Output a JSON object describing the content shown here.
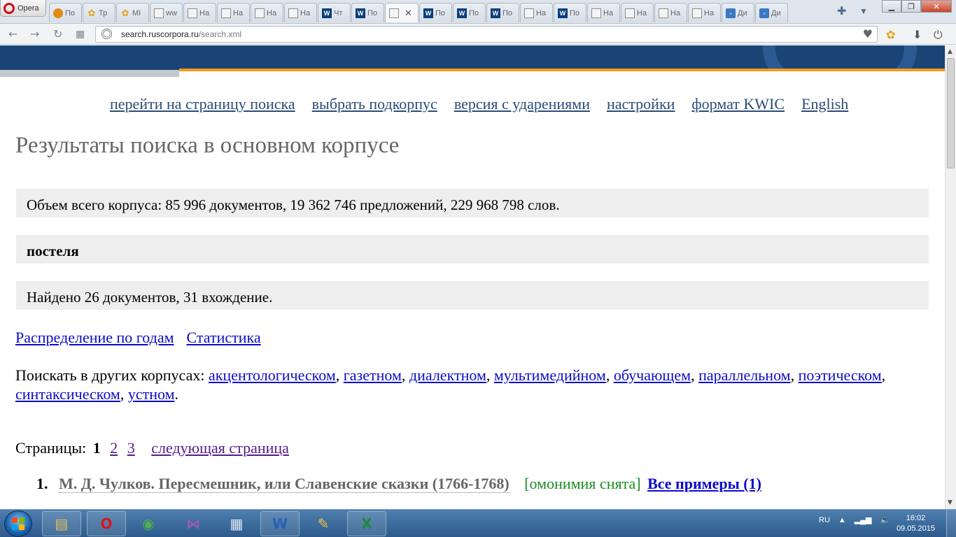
{
  "browser": {
    "menu_label": "Opera",
    "tabs": [
      {
        "label": "По",
        "icon": "orange-ball-icon"
      },
      {
        "label": "Тр",
        "icon": "flower-icon"
      },
      {
        "label": "МІ",
        "icon": "flower-icon"
      },
      {
        "label": "ww",
        "icon": "page-icon"
      },
      {
        "label": "На",
        "icon": "page-icon"
      },
      {
        "label": "На",
        "icon": "page-icon"
      },
      {
        "label": "На",
        "icon": "page-icon"
      },
      {
        "label": "На",
        "icon": "page-icon"
      },
      {
        "label": "Чт",
        "icon": "nkrja-icon"
      },
      {
        "label": "По",
        "icon": "nkrja-icon"
      },
      {
        "label": "",
        "icon": "page-icon",
        "active": true
      },
      {
        "label": "По",
        "icon": "nkrja-icon"
      },
      {
        "label": "По",
        "icon": "nkrja-icon"
      },
      {
        "label": "По",
        "icon": "nkrja-icon"
      },
      {
        "label": "На",
        "icon": "page-icon"
      },
      {
        "label": "По",
        "icon": "nkrja-icon"
      },
      {
        "label": "На",
        "icon": "page-icon"
      },
      {
        "label": "На",
        "icon": "page-icon"
      },
      {
        "label": "На",
        "icon": "page-icon"
      },
      {
        "label": "На",
        "icon": "page-icon"
      },
      {
        "label": "Ди",
        "icon": "chat-icon"
      },
      {
        "label": "Ди",
        "icon": "chat-icon"
      }
    ],
    "url_host": "search.ruscorpora.ru",
    "url_path": "/search.xml"
  },
  "page": {
    "top_nav": [
      "перейти на страницу поиска",
      "выбрать подкорпус",
      "версия с ударениями",
      "настройки",
      "формат KWIC",
      "English"
    ],
    "title": "Результаты поиска в основном корпусе",
    "corpus_size": "Объем всего корпуса: 85 996 документов, 19 362 746 предложений, 229 968 798 слов.",
    "query": "постеля",
    "found": "Найдено 26 документов, 31 вхождение.",
    "links": [
      "Распределение по годам",
      "Статистика"
    ],
    "other_corpora_label": "Поискать в других корпусах:",
    "other_corpora": [
      "акцентологическом",
      "газетном",
      "диалектном",
      "мультимедийном",
      "обучающем",
      "параллельном",
      "поэтическом",
      "синтаксическом",
      "устном"
    ],
    "pages_label": "Страницы:",
    "current_page": "1",
    "pages": [
      "2",
      "3"
    ],
    "next_page": "следующая страница",
    "result": {
      "number": "1.",
      "title": "М. Д. Чулков. Пересмешник, или Славенские сказки (1766-1768)",
      "homonymy": "[омонимия снята]",
      "all_examples": "Все примеры (1)"
    }
  },
  "taskbar": {
    "language": "RU",
    "time": "16:02",
    "date": "09.05.2015"
  },
  "colors": {
    "banner": "#1a4476",
    "accent_orange": "#f39a1c",
    "nav_link": "#2b4b78",
    "link": "#0b0bcc",
    "homonymy_green": "#1b8a22"
  }
}
